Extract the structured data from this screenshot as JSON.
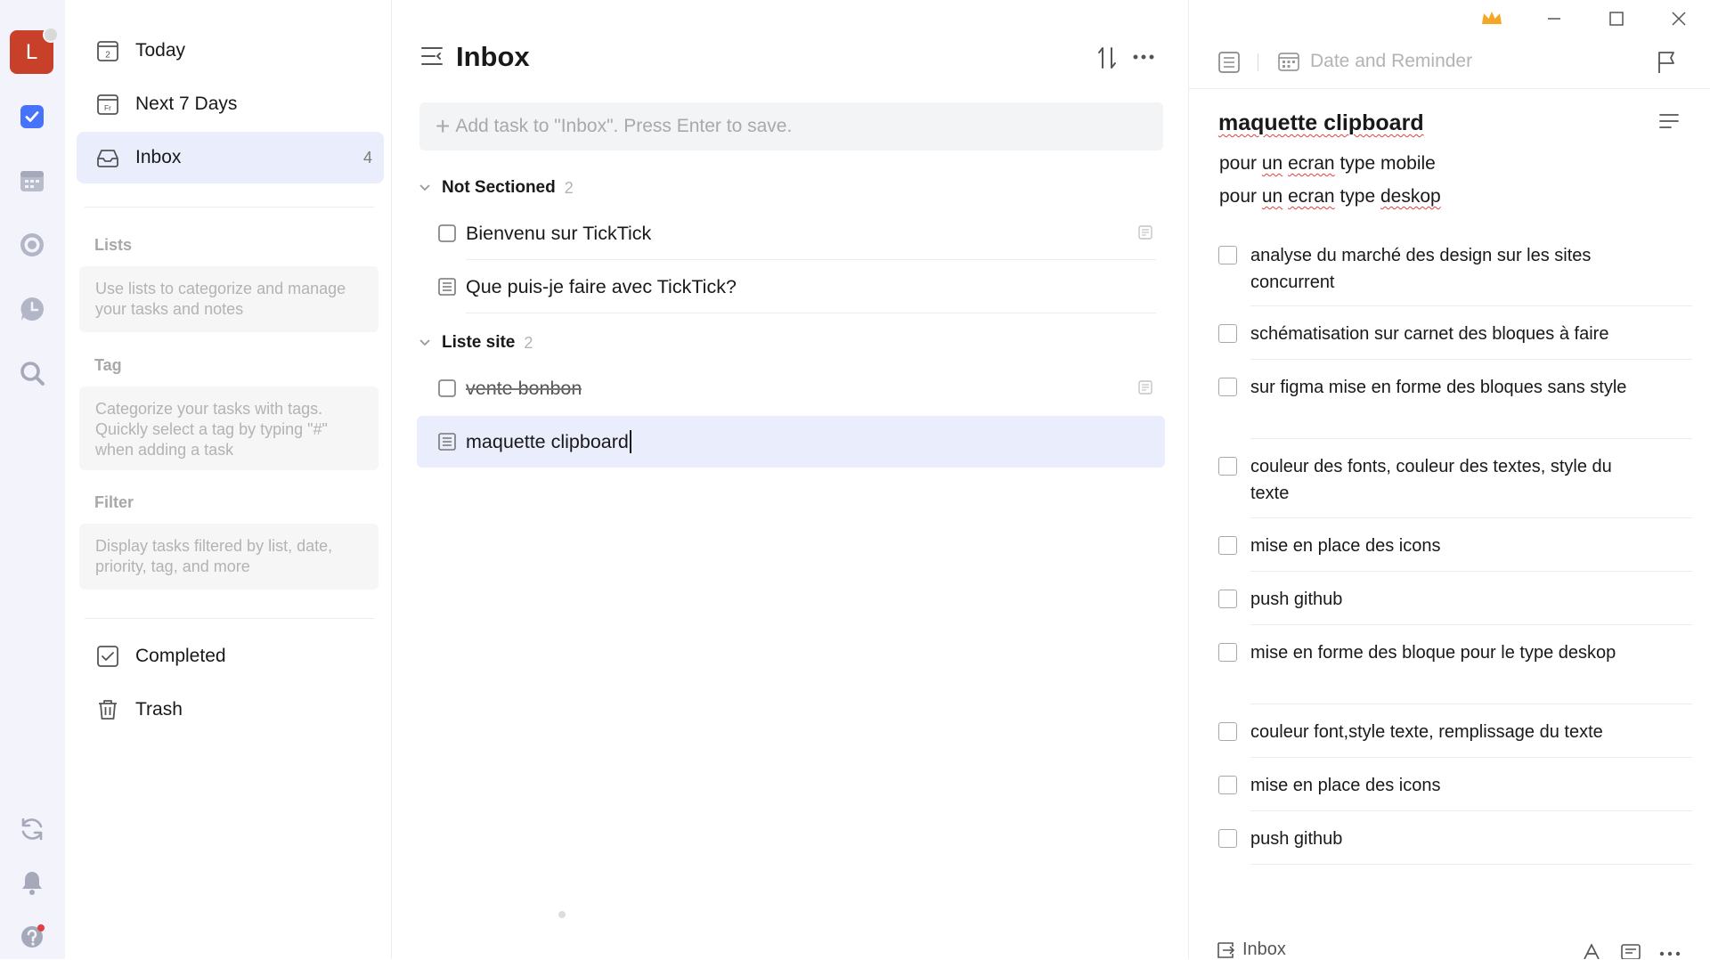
{
  "rail": {
    "avatar_letter": "L",
    "accent": "#4772fa"
  },
  "sidebar": {
    "nav": [
      {
        "label": "Today",
        "icon": "calendar-today-icon",
        "day": "2"
      },
      {
        "label": "Next 7 Days",
        "icon": "calendar-week-icon",
        "day": "Fr"
      },
      {
        "label": "Inbox",
        "icon": "inbox-icon",
        "count": "4"
      }
    ],
    "lists": {
      "heading": "Lists",
      "hint": "Use lists to categorize and manage your tasks and notes"
    },
    "tags": {
      "heading": "Tag",
      "hint": "Categorize your tasks with tags. Quickly select a tag by typing \"#\" when adding a task"
    },
    "filters": {
      "heading": "Filter",
      "hint": "Display tasks filtered by list, date, priority, tag, and more"
    },
    "bottom": [
      {
        "label": "Completed",
        "icon": "completed-icon"
      },
      {
        "label": "Trash",
        "icon": "trash-icon"
      }
    ]
  },
  "list": {
    "title": "Inbox",
    "add_placeholder": "Add task to \"Inbox\". Press Enter to save.",
    "sections": [
      {
        "name": "Not Sectioned",
        "count": "2",
        "tasks": [
          {
            "title": "Bienvenu sur TickTick",
            "kind": "checkbox"
          },
          {
            "title": "Que puis-je faire avec TickTick?",
            "kind": "note"
          }
        ]
      },
      {
        "name": "Liste site",
        "count": "2",
        "tasks": [
          {
            "title": "vente bonbon",
            "kind": "checkbox"
          },
          {
            "title": "maquette clipboard",
            "kind": "note",
            "selected": true
          }
        ]
      }
    ]
  },
  "detail": {
    "date_reminder": "Date and Reminder",
    "title": "maquette clipboard",
    "description": [
      [
        "pour ",
        "un",
        " ",
        "ecran",
        " type mobile"
      ],
      [
        "pour ",
        "un",
        " ",
        "ecran",
        " type ",
        "deskop",
        ""
      ]
    ],
    "checklist": [
      "analyse du marché des design sur les sites concurrent",
      "schématisation sur carnet des bloques à faire",
      "sur figma mise en forme des bloques sans style",
      "couleur des fonts, couleur des textes, style du texte",
      "mise en place des icons",
      "push github",
      "mise en forme des bloque pour le type deskop",
      "couleur font,style texte, remplissage du texte",
      "mise en place des icons",
      "push github"
    ],
    "footer_list": "Inbox"
  }
}
